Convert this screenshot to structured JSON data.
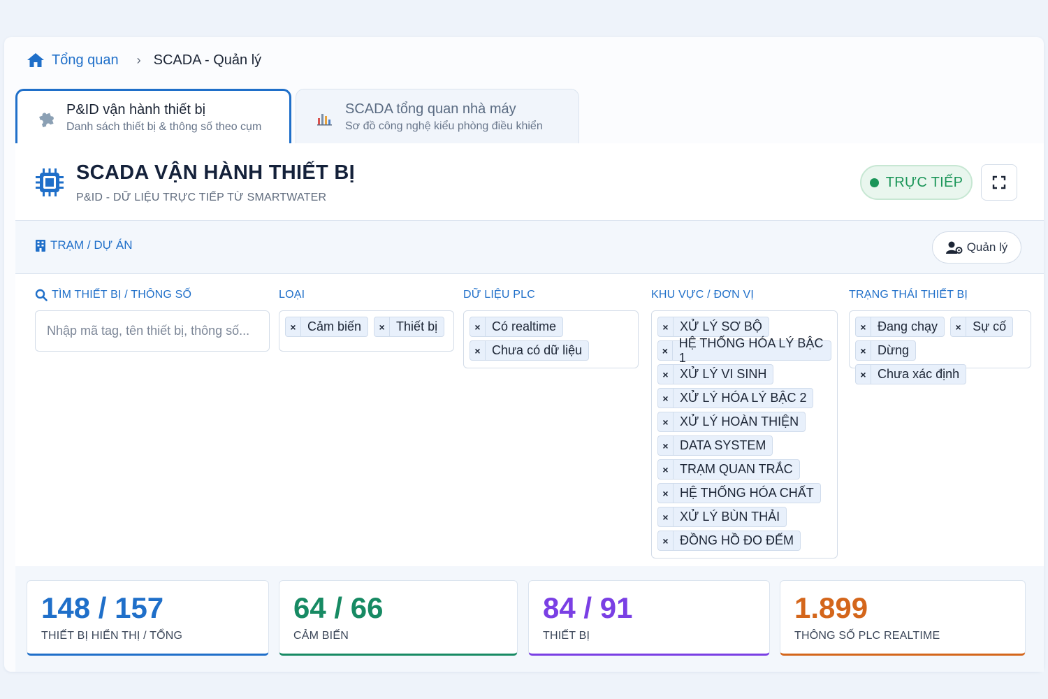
{
  "breadcrumb": {
    "home": "Tổng quan",
    "current": "SCADA - Quản lý"
  },
  "tabs": [
    {
      "title": "P&ID vận hành thiết bị",
      "subtitle": "Danh sách thiết bị & thông số theo cụm",
      "icon": "puzzle-icon",
      "active": true
    },
    {
      "title": "SCADA tổng quan nhà máy",
      "subtitle": "Sơ đồ công nghệ kiểu phòng điều khiển",
      "icon": "bar-chart-icon",
      "active": false
    }
  ],
  "header": {
    "title": "SCADA VẬN HÀNH THIẾT BỊ",
    "subtitle": "P&ID - DỮ LIỆU TRỰC TIẾP TỪ SMARTWATER",
    "live_label": "TRỰC TIẾP"
  },
  "station": {
    "label": "TRẠM / DỰ ÁN",
    "manage_label": "Quản lý"
  },
  "filters": {
    "search": {
      "label": "TÌM THIẾT BỊ / THÔNG SỐ",
      "placeholder": "Nhập mã tag, tên thiết bị, thông số..."
    },
    "type": {
      "label": "LOẠI",
      "tags": [
        "Cảm biến",
        "Thiết bị"
      ]
    },
    "plc": {
      "label": "DỮ LIỆU PLC",
      "tags": [
        "Có realtime",
        "Chưa có dữ liệu"
      ]
    },
    "area": {
      "label": "KHU VỰC / ĐƠN VỊ",
      "tags": [
        "XỬ LÝ SƠ BỘ",
        "HỆ THỐNG HÓA LÝ BẬC 1",
        "XỬ LÝ VI SINH",
        "XỬ LÝ HÓA LÝ BẬC 2",
        "XỬ LÝ HOÀN THIỆN",
        "DATA SYSTEM",
        "TRẠM QUAN TRẮC",
        "HỆ THỐNG HÓA CHẤT",
        "XỬ LÝ BÙN THẢI",
        "ĐỒNG HỒ ĐO ĐẾM"
      ]
    },
    "status": {
      "label": "TRẠNG THÁI THIẾT BỊ",
      "tags": [
        "Đang chạy",
        "Sự cố",
        "Dừng",
        "Chưa xác định"
      ]
    }
  },
  "stats": [
    {
      "value": "148 / 157",
      "label": "THIẾT BỊ HIỂN THỊ / TỔNG",
      "color": "#1f6fc9"
    },
    {
      "value": "64 / 66",
      "label": "CẢM BIẾN",
      "color": "#178a63"
    },
    {
      "value": "84 / 91",
      "label": "THIẾT BỊ",
      "color": "#7a3fe4"
    },
    {
      "value": "1.899",
      "label": "THÔNG SỐ PLC REALTIME",
      "color": "#d4661b"
    }
  ],
  "colors": {
    "accent": "#1f6fc9",
    "live": "#1a9558"
  }
}
